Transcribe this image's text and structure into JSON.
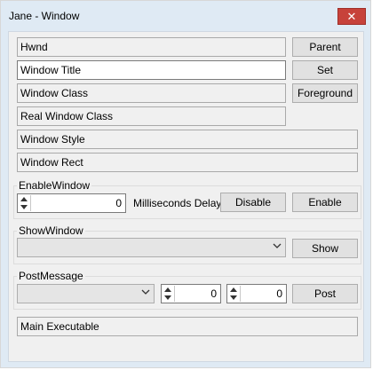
{
  "window": {
    "title": "Jane - Window",
    "close_glyph": "✕"
  },
  "fields": {
    "hwnd": "Hwnd",
    "window_title": "Window Title",
    "window_class": "Window Class",
    "real_window_class": "Real Window Class",
    "window_style": "Window Style",
    "window_rect": "Window Rect",
    "main_executable": "Main Executable"
  },
  "buttons": {
    "parent": "Parent",
    "set": "Set",
    "foreground": "Foreground",
    "disable": "Disable",
    "enable": "Enable",
    "show": "Show",
    "post": "Post"
  },
  "enable_window": {
    "label": "EnableWindow",
    "delay_value": "0",
    "delay_label": "Milliseconds Delay"
  },
  "show_window": {
    "label": "ShowWindow",
    "selected": ""
  },
  "post_message": {
    "label": "PostMessage",
    "selected": "",
    "wparam": "0",
    "lparam": "0"
  },
  "icons": {
    "close": "close-icon",
    "spin": "spin-arrows-icon",
    "dropdown": "chevron-down-icon"
  }
}
